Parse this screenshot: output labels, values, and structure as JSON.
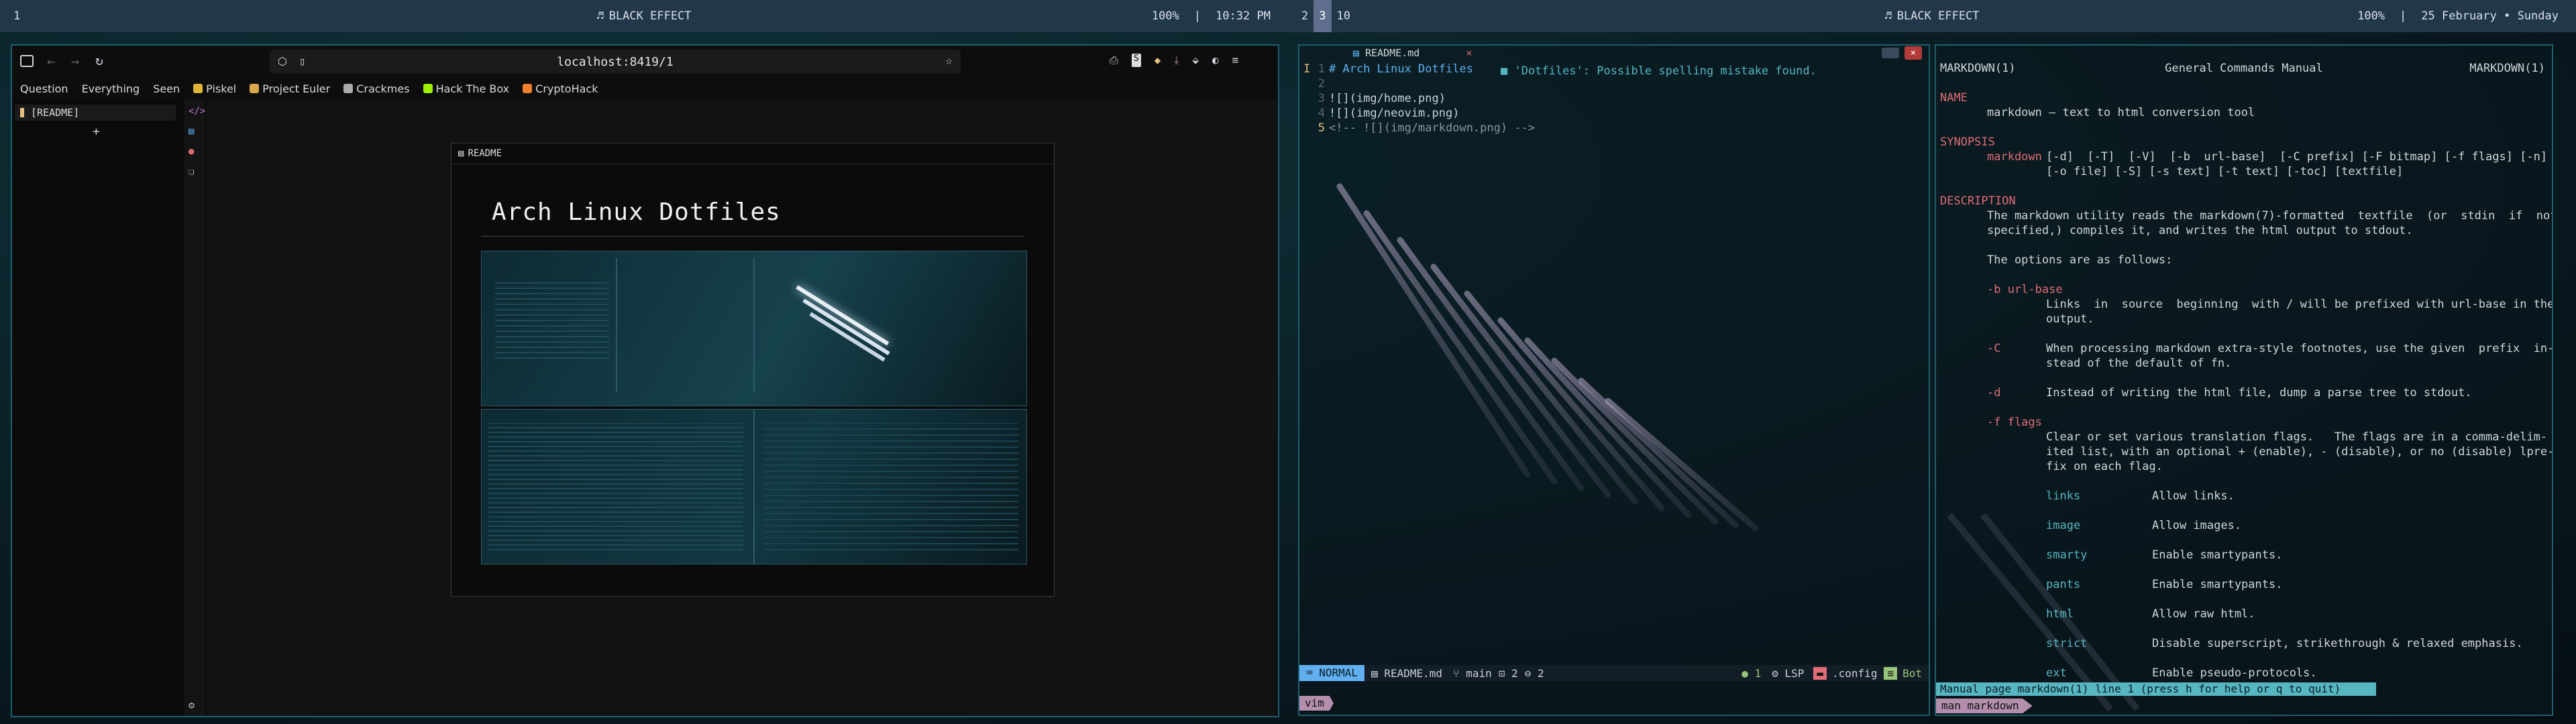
{
  "topbar_left": {
    "workspace": "1",
    "title": "BLACK EFFECT",
    "volume": "100%",
    "sep": "|",
    "time": "10:32 PM"
  },
  "topbar_right": {
    "workspaces": [
      "2",
      "3",
      "10"
    ],
    "active_workspace": "3",
    "title": "BLACK EFFECT",
    "volume": "100%",
    "sep": "|",
    "date": "25 February • Sunday"
  },
  "browser": {
    "url": "localhost:8419/1",
    "bookmarks": [
      {
        "label": "Question",
        "icon_color": ""
      },
      {
        "label": "Everything",
        "icon_color": ""
      },
      {
        "label": "Seen",
        "icon_color": ""
      },
      {
        "label": "Piskel",
        "icon_color": "#e0b437"
      },
      {
        "label": "Project Euler",
        "icon_color": "#d9a64b"
      },
      {
        "label": "Crackmes",
        "icon_color": "#aaaaaa"
      },
      {
        "label": "Hack The Box",
        "icon_color": "#9fef00"
      },
      {
        "label": "CryptoHack",
        "icon_color": "#f08030"
      }
    ],
    "tree_item": "[README]",
    "plus": "+",
    "preview_tab": "README",
    "heading": "Arch Linux Dotfiles"
  },
  "nvim": {
    "tab": "README.md",
    "tab_close": "×",
    "lines": [
      {
        "num": "1",
        "sign": "I",
        "text": "# Arch Linux Dotfiles"
      },
      {
        "num": "2",
        "sign": "",
        "text": ""
      },
      {
        "num": "3",
        "sign": "",
        "text": "![](img/home.png)"
      },
      {
        "num": "4",
        "sign": "",
        "text": "![](img/neovim.png)"
      },
      {
        "num": "5",
        "sign": "",
        "text": "<!-- ![](img/markdown.png) -->"
      }
    ],
    "diagnostic": "■ 'Dotfiles': Possible spelling mistake found.",
    "status": {
      "mode": "NORMAL",
      "file": "README.md",
      "branch": "main",
      "diff_count": "2",
      "changes": "2",
      "lsp_count": "1",
      "lsp": "LSP",
      "dir": ".config",
      "pos": "Bot"
    },
    "cmdline": "vim"
  },
  "man": {
    "header_left": "MARKDOWN(1)",
    "header_center": "General Commands Manual",
    "header_right": "MARKDOWN(1)",
    "sections": {
      "name": "NAME",
      "name_text": "markdown — text to html conversion tool",
      "synopsis": "SYNOPSIS",
      "synopsis_cmd": "markdown",
      "synopsis_l1": "[-d]  [-T]  [-V]  [-b  url-base]  [-C prefix] [-F bitmap] [-f flags] [-n]",
      "synopsis_l2": "[-o file] [-S] [-s text] [-t text] [-toc] [textfile]",
      "description": "DESCRIPTION",
      "desc_l1": "The markdown utility reads the markdown(7)-formatted  textfile  (or  stdin  if  not",
      "desc_l2": "specified,) compiles it, and writes the html output to stdout.",
      "desc_l3": "The options are as follows:"
    },
    "options": [
      {
        "flag": "-b url-base",
        "lines": [
          "Links  in  source  beginning  with / will be prefixed with url-base in the",
          "output."
        ]
      },
      {
        "flag": "-C",
        "lines": [
          "When processing markdown extra-style footnotes, use the given  prefix  in-",
          "stead of the default of fn."
        ]
      },
      {
        "flag": "-d",
        "lines": [
          "Instead of writing the html file, dump a parse tree to stdout."
        ]
      },
      {
        "flag": "-f flags",
        "lines": []
      }
    ],
    "flags_intro": [
      "Clear or set various translation flags.   The flags are in a comma-delim-",
      "ited list, with an optional + (enable), - (disable), or no (disable) lpre-",
      "fix on each flag."
    ],
    "flag_table": [
      {
        "k": "links",
        "v": "Allow links."
      },
      {
        "k": "image",
        "v": "Allow images."
      },
      {
        "k": "smarty",
        "v": "Enable smartypants."
      },
      {
        "k": "pants",
        "v": "Enable smartypants."
      },
      {
        "k": "html",
        "v": "Allow raw html."
      },
      {
        "k": "strict",
        "v": "Disable superscript, strikethrough & relaxed emphasis."
      },
      {
        "k": "ext",
        "v": "Enable pseudo-protocols."
      }
    ],
    "status": "Manual page markdown(1) line 1 (press h for help or q to quit)",
    "cmdline": "man markdown"
  }
}
